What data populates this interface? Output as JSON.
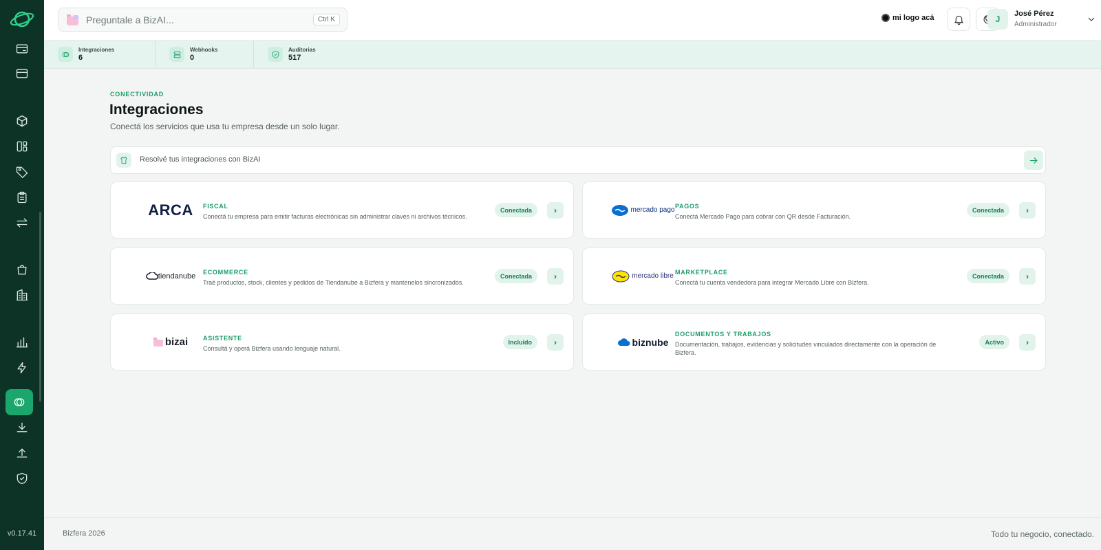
{
  "app": {
    "version": "v0.17.41"
  },
  "search": {
    "placeholder": "Preguntale a BizAI...",
    "shortcut": "Ctrl K"
  },
  "topbar": {
    "brand_logo": "mi logo acá",
    "user_name": "José Pérez",
    "user_role": "Administrador",
    "avatar_initial": "J"
  },
  "stats": [
    {
      "label": "Integraciones",
      "value": "6"
    },
    {
      "label": "Webhooks",
      "value": "0"
    },
    {
      "label": "Auditorias",
      "value": "517"
    }
  ],
  "page": {
    "eyebrow": "CONECTIVIDAD",
    "title": "Integraciones",
    "subtitle": "Conectá los servicios que usa tu empresa desde un solo lugar.",
    "ai_prompt": "Resolvé tus integraciones con BizAI"
  },
  "cards": [
    {
      "logo": "ARCA",
      "category": "FISCAL",
      "description": "Conectá tu empresa para emitir facturas electrónicas sin administrar claves ni archivos técnicos.",
      "status": "Conectada"
    },
    {
      "logo": "mercado pago",
      "category": "PAGOS",
      "description": "Conectá Mercado Pago para cobrar con QR desde Facturación.",
      "status": "Conectada"
    },
    {
      "logo": "tiendanube",
      "category": "ECOMMERCE",
      "description": "Traé productos, stock, clientes y pedidos de Tiendanube a Bizfera y mantenelos sincronizados.",
      "status": "Conectada"
    },
    {
      "logo": "mercado libre",
      "category": "MARKETPLACE",
      "description": "Conectá tu cuenta vendedora para integrar Mercado Libre con Bizfera.",
      "status": "Conectada"
    },
    {
      "logo": "bizai",
      "category": "ASISTENTE",
      "description": "Consultá y operá Bizfera usando lenguaje natural.",
      "status": "Incluido"
    },
    {
      "logo": "biznube",
      "category": "DOCUMENTOS Y TRABAJOS",
      "description": "Documentación, trabajos, evidencias y solicitudes vinculados directamente con la operación de Bizfera.",
      "status": "Activo"
    }
  ],
  "footer": {
    "left": "Bizfera 2026",
    "right": "Todo tu negocio, conectado."
  },
  "colors": {
    "sidebar": "#0d3326",
    "accent": "#1aa66d",
    "badge_bg": "#e2f3ec",
    "background": "#f3f5f4"
  }
}
